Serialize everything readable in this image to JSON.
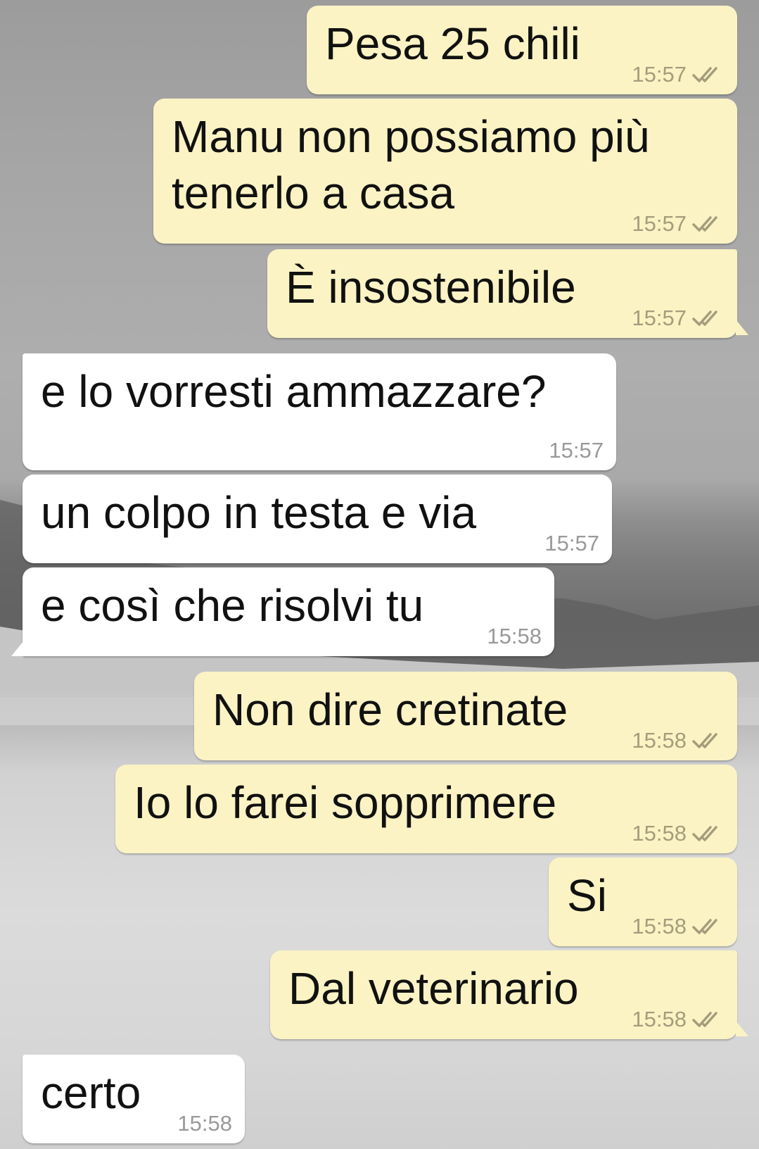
{
  "messages": [
    {
      "text": "Pesa 25 chili",
      "time": "15:57",
      "direction": "outgoing",
      "status_icon": "double-check-icon"
    },
    {
      "lines": [
        "Manu non possiamo più",
        "tenerlo a casa"
      ],
      "time": "15:57",
      "direction": "outgoing",
      "status_icon": "double-check-icon"
    },
    {
      "text": "È insostenibile",
      "time": "15:57",
      "direction": "outgoing",
      "status_icon": "double-check-icon"
    },
    {
      "text": "e lo vorresti ammazzare?",
      "time": "15:57",
      "direction": "incoming"
    },
    {
      "text": "un colpo in testa e via",
      "time": "15:57",
      "direction": "incoming"
    },
    {
      "text": "e così che risolvi tu",
      "time": "15:58",
      "direction": "incoming"
    },
    {
      "text": "Non dire cretinate",
      "time": "15:58",
      "direction": "outgoing",
      "status_icon": "double-check-icon"
    },
    {
      "text": "Io lo farei sopprimere",
      "time": "15:58",
      "direction": "outgoing",
      "status_icon": "double-check-icon"
    },
    {
      "text": "Si",
      "time": "15:58",
      "direction": "outgoing",
      "status_icon": "double-check-icon"
    },
    {
      "text": "Dal veterinario",
      "time": "15:58",
      "direction": "outgoing",
      "status_icon": "double-check-icon"
    },
    {
      "text": "certo",
      "time": "15:58",
      "direction": "incoming"
    }
  ],
  "colors": {
    "outgoing_bubble": "#fbf3c4",
    "incoming_bubble": "#ffffff",
    "outgoing_time": "#a49d7c",
    "incoming_time": "#999999",
    "tick": "#a49d7c"
  },
  "wallpaper": "snowy-field-photo"
}
